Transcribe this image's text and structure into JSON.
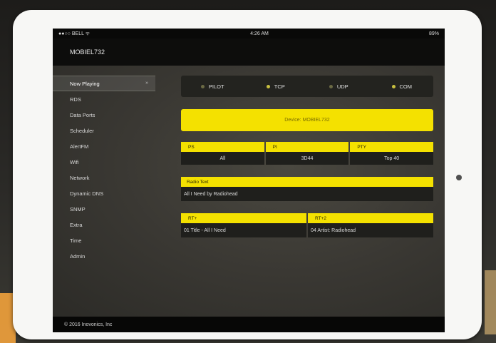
{
  "status": {
    "carrier": "●●○○ BELL ᯤ",
    "time": "4:26 AM",
    "battery": "89%"
  },
  "app": {
    "title": "MOBIEL732"
  },
  "sidebar": {
    "items": [
      {
        "label": "Now Playing",
        "active": true,
        "chevron": "»"
      },
      {
        "label": "RDS"
      },
      {
        "label": "Data Ports"
      },
      {
        "label": "Scheduler"
      },
      {
        "label": "AlertFM"
      },
      {
        "label": "Wifi"
      },
      {
        "label": "Network"
      },
      {
        "label": "Dynamic DNS"
      },
      {
        "label": "SNMP"
      },
      {
        "label": "Extra"
      },
      {
        "label": "Time"
      },
      {
        "label": "Admin"
      }
    ]
  },
  "main": {
    "tabs": [
      {
        "label": "PILOT",
        "state": "off"
      },
      {
        "label": "TCP",
        "state": "on"
      },
      {
        "label": "UDP",
        "state": "off"
      },
      {
        "label": "COM",
        "state": "on"
      }
    ],
    "device_button": "Device: MOBIEL732",
    "info_row": [
      {
        "head": "PS",
        "value": "All"
      },
      {
        "head": "PI",
        "value": "3D44"
      },
      {
        "head": "PTY",
        "value": "Top 40"
      }
    ],
    "radiotext": {
      "head": "Radio Text",
      "value": "All I Need by Radiohead"
    },
    "rtplus": [
      {
        "head": "RT+",
        "value": "01 Title - All I Need"
      },
      {
        "head": "RT+2",
        "value": "04 Artist: Radiohead"
      }
    ]
  },
  "footer": {
    "text": "© 2016 Inovonics, Inc"
  },
  "colors": {
    "accent": "#f4e100",
    "background": "#3a3833"
  }
}
